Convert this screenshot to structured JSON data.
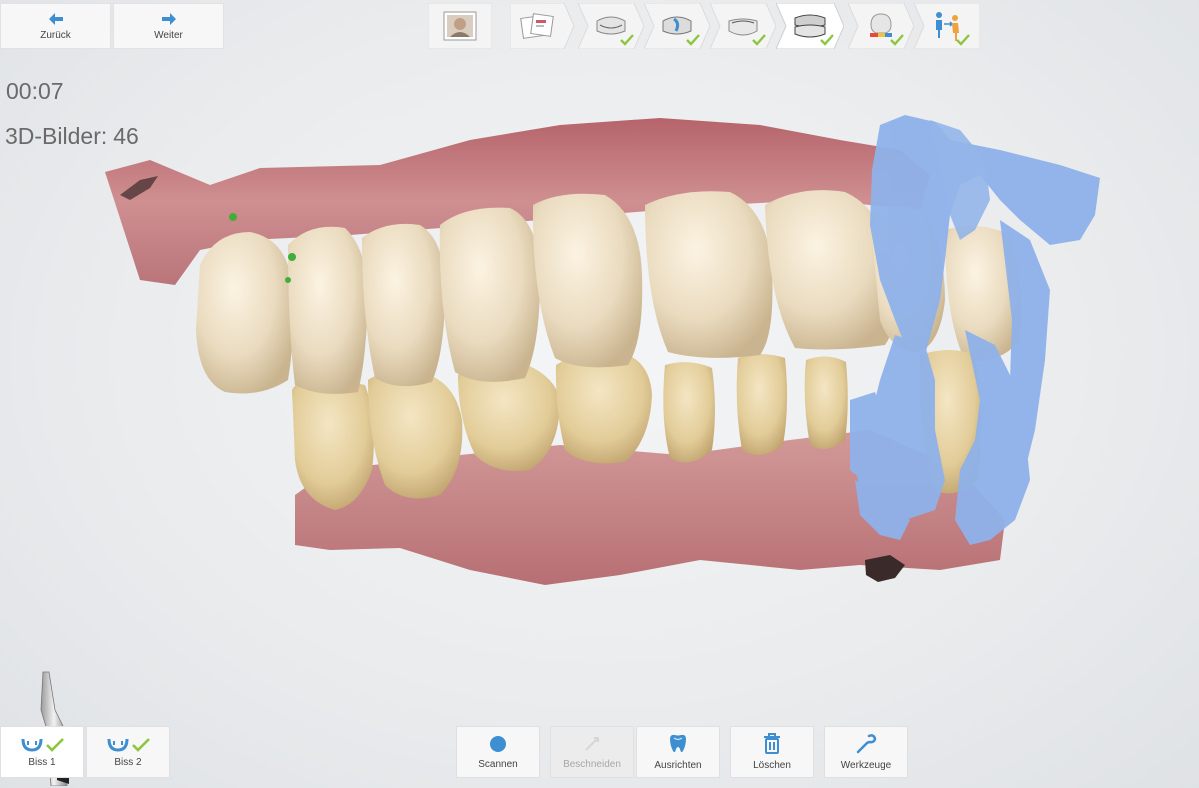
{
  "nav": {
    "back_label": "Zurück",
    "forward_label": "Weiter"
  },
  "workflow": {
    "steps": [
      {
        "icon": "patient-photo-icon",
        "completed": false
      },
      {
        "icon": "rx-form-icon",
        "completed": false
      },
      {
        "icon": "upper-jaw-icon",
        "completed": true
      },
      {
        "icon": "upper-jaw-prep-icon",
        "completed": true
      },
      {
        "icon": "lower-jaw-icon",
        "completed": true
      },
      {
        "icon": "bite-scan-icon",
        "completed": true
      },
      {
        "icon": "model-analysis-icon",
        "completed": true
      },
      {
        "icon": "send-to-lab-icon",
        "completed": true
      }
    ],
    "active_step": 5
  },
  "status": {
    "timer": "00:07",
    "images_label": "3D-Bilder:",
    "images_count": "46"
  },
  "bite_buttons": [
    {
      "label": "Biss 1",
      "icon": "bite-jaw-icon",
      "completed": true,
      "active": true
    },
    {
      "label": "Biss 2",
      "icon": "bite-jaw-icon",
      "completed": true,
      "active": false
    }
  ],
  "tools": [
    {
      "label": "Scannen",
      "icon": "scan-record-icon",
      "enabled": true
    },
    {
      "label": "Beschneiden",
      "icon": "trim-icon",
      "enabled": false
    },
    {
      "label": "Ausrichten",
      "icon": "align-tooth-icon",
      "enabled": true
    },
    {
      "label": "Löschen",
      "icon": "trash-icon",
      "enabled": true
    },
    {
      "label": "Werkzeuge",
      "icon": "wrench-icon",
      "enabled": true
    }
  ],
  "colors": {
    "accent": "#3d8fd1",
    "check": "#8cc63e",
    "scan_blue": "#8fb2ea",
    "gum": "#c9858a",
    "tooth": "#eadbbf"
  }
}
